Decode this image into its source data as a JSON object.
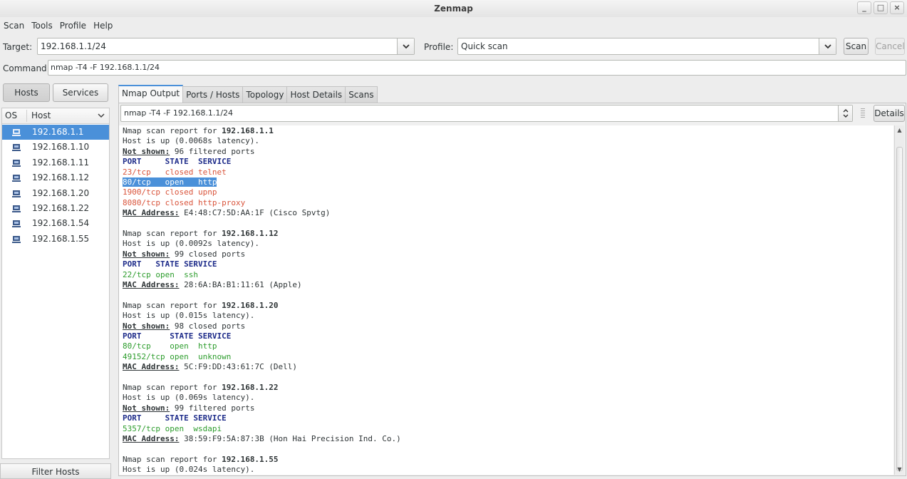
{
  "window": {
    "title": "Zenmap",
    "controls": [
      "_",
      "□",
      "×"
    ]
  },
  "menu": [
    "Scan",
    "Tools",
    "Profile",
    "Help"
  ],
  "toolbar": {
    "target_label": "Target:",
    "target_value": "192.168.1.1/24",
    "profile_label": "Profile:",
    "profile_value": "Quick scan",
    "scan_label": "Scan",
    "cancel_label": "Cancel",
    "command_label": "Command:",
    "command_value": "nmap -T4 -F 192.168.1.1/24"
  },
  "left": {
    "hosts_btn": "Hosts",
    "services_btn": "Services",
    "col_os": "OS",
    "col_host": "Host",
    "hosts": [
      "192.168.1.1",
      "192.168.1.10",
      "192.168.1.11",
      "192.168.1.12",
      "192.168.1.20",
      "192.168.1.22",
      "192.168.1.54",
      "192.168.1.55"
    ],
    "filter_label": "Filter Hosts"
  },
  "tabs": [
    "Nmap Output",
    "Ports / Hosts",
    "Topology",
    "Host Details",
    "Scans"
  ],
  "output": {
    "selector_value": "nmap -T4 -F 192.168.1.1/24",
    "details_label": "Details",
    "lines": [
      [
        [
          "n",
          "Nmap scan report for "
        ],
        [
          "b",
          "192.168.1.1"
        ]
      ],
      [
        [
          "n",
          "Host is up (0.0068s latency)."
        ]
      ],
      [
        [
          "u",
          "Not shown:"
        ],
        [
          "n",
          " 96 filtered ports"
        ]
      ],
      [
        [
          "blue",
          "PORT     STATE  SERVICE"
        ]
      ],
      [
        [
          "red",
          "23/tcp   closed telnet"
        ]
      ],
      [
        [
          "sel",
          "80/tcp   open   http"
        ]
      ],
      [
        [
          "red",
          "1900/tcp closed upnp"
        ]
      ],
      [
        [
          "red",
          "8080/tcp closed http-proxy"
        ]
      ],
      [
        [
          "u",
          "MAC Address:"
        ],
        [
          "n",
          " E4:48:C7:5D:AA:1F (Cisco Spvtg)"
        ]
      ],
      [
        [
          "n",
          ""
        ]
      ],
      [
        [
          "n",
          "Nmap scan report for "
        ],
        [
          "b",
          "192.168.1.12"
        ]
      ],
      [
        [
          "n",
          "Host is up (0.0092s latency)."
        ]
      ],
      [
        [
          "u",
          "Not shown:"
        ],
        [
          "n",
          " 99 closed ports"
        ]
      ],
      [
        [
          "blue",
          "PORT   STATE SERVICE"
        ]
      ],
      [
        [
          "green",
          "22/tcp open  ssh"
        ]
      ],
      [
        [
          "u",
          "MAC Address:"
        ],
        [
          "n",
          " 28:6A:BA:B1:11:61 (Apple)"
        ]
      ],
      [
        [
          "n",
          ""
        ]
      ],
      [
        [
          "n",
          "Nmap scan report for "
        ],
        [
          "b",
          "192.168.1.20"
        ]
      ],
      [
        [
          "n",
          "Host is up (0.015s latency)."
        ]
      ],
      [
        [
          "u",
          "Not shown:"
        ],
        [
          "n",
          " 98 closed ports"
        ]
      ],
      [
        [
          "blue",
          "PORT      STATE SERVICE"
        ]
      ],
      [
        [
          "green",
          "80/tcp    open  http"
        ]
      ],
      [
        [
          "green",
          "49152/tcp open  unknown"
        ]
      ],
      [
        [
          "u",
          "MAC Address:"
        ],
        [
          "n",
          " 5C:F9:DD:43:61:7C (Dell)"
        ]
      ],
      [
        [
          "n",
          ""
        ]
      ],
      [
        [
          "n",
          "Nmap scan report for "
        ],
        [
          "b",
          "192.168.1.22"
        ]
      ],
      [
        [
          "n",
          "Host is up (0.069s latency)."
        ]
      ],
      [
        [
          "u",
          "Not shown:"
        ],
        [
          "n",
          " 99 filtered ports"
        ]
      ],
      [
        [
          "blue",
          "PORT     STATE SERVICE"
        ]
      ],
      [
        [
          "green",
          "5357/tcp open  wsdapi"
        ]
      ],
      [
        [
          "u",
          "MAC Address:"
        ],
        [
          "n",
          " 38:59:F9:5A:87:3B (Hon Hai Precision Ind. Co.)"
        ]
      ],
      [
        [
          "n",
          ""
        ]
      ],
      [
        [
          "n",
          "Nmap scan report for "
        ],
        [
          "b",
          "192.168.1.55"
        ]
      ],
      [
        [
          "n",
          "Host is up (0.024s latency)."
        ]
      ]
    ]
  },
  "colors": {
    "selection": "#4a90d9",
    "closed": "#d9543b",
    "open": "#2c9c2c",
    "header": "#1e2c8a"
  }
}
